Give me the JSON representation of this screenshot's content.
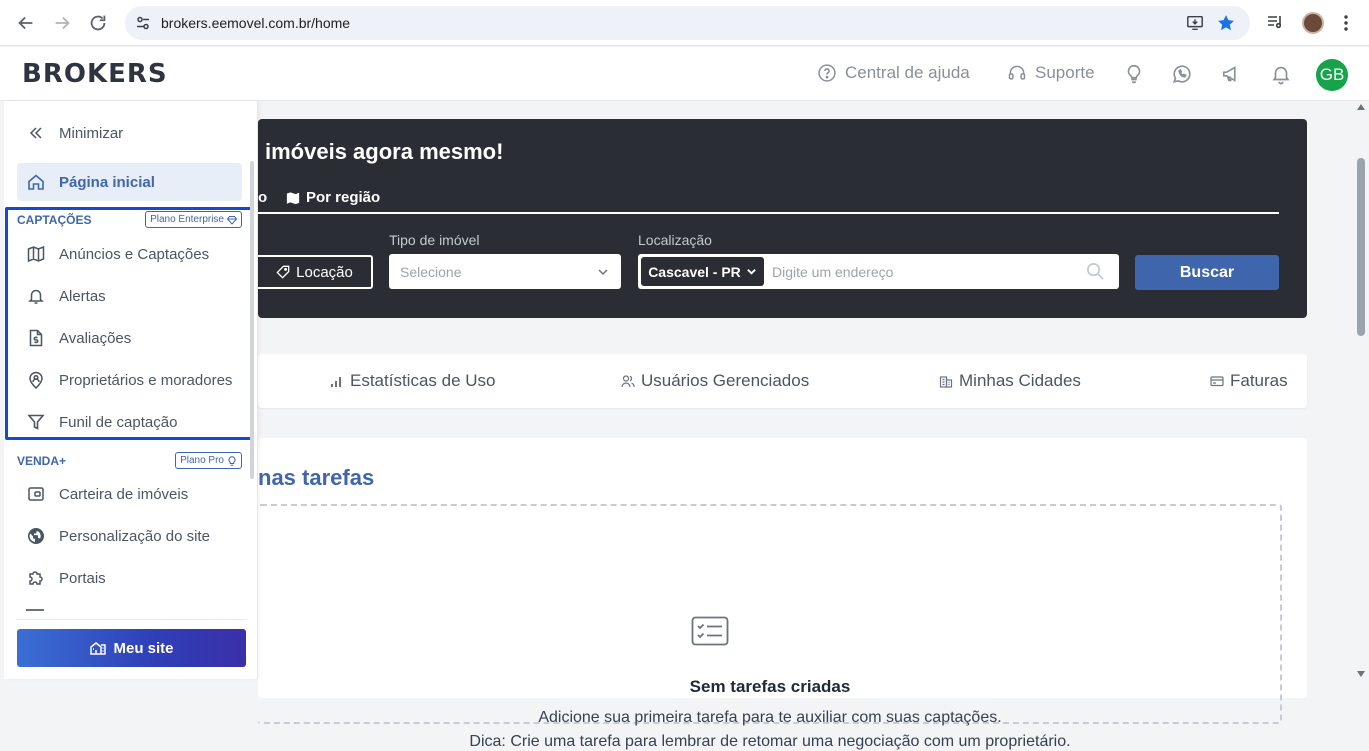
{
  "browser": {
    "url": "brokers.eemovel.com.br/home"
  },
  "header": {
    "logo": "BROKERS",
    "help_label": "Central de ajuda",
    "support_label": "Suporte",
    "avatar_initials": "GB",
    "avatar_color": "#16a34a"
  },
  "sidebar": {
    "minimize_label": "Minimizar",
    "home_label": "Página inicial",
    "captacoes": {
      "title": "CAPTAÇÕES",
      "plan": "Plano Enterprise",
      "items": [
        {
          "label": "Anúncios e Captações",
          "icon": "map-icon"
        },
        {
          "label": "Alertas",
          "icon": "bell-icon"
        },
        {
          "label": "Avaliações",
          "icon": "document-dollar-icon"
        },
        {
          "label": "Proprietários e moradores",
          "icon": "location-person-icon"
        },
        {
          "label": "Funil de captação",
          "icon": "filter-icon"
        }
      ]
    },
    "venda": {
      "title": "VENDA+",
      "plan": "Plano Pro",
      "items": [
        {
          "label": "Carteira de imóveis",
          "icon": "wallet-icon"
        },
        {
          "label": "Personalização do site",
          "icon": "globe-icon"
        },
        {
          "label": "Portais",
          "icon": "puzzle-icon"
        }
      ]
    },
    "my_site_label": "Meu site"
  },
  "hero": {
    "title": "imóveis agora mesmo!",
    "tab_partial": "o",
    "tab_region": "Por região",
    "rent_button": "Locação",
    "property_type_label": "Tipo de imóvel",
    "property_type_placeholder": "Selecione",
    "location_label": "Localização",
    "city": "Cascavel - PR",
    "address_placeholder": "Digite um endereço",
    "search_button": "Buscar"
  },
  "stats_bar": {
    "items": [
      {
        "label": "Estatísticas de Uso",
        "icon": "bar-chart-icon"
      },
      {
        "label": "Usuários Gerenciados",
        "icon": "users-icon"
      },
      {
        "label": "Minhas Cidades",
        "icon": "buildings-icon"
      },
      {
        "label": "Faturas",
        "icon": "card-icon"
      }
    ]
  },
  "tasks": {
    "heading": "nas tarefas",
    "empty_title": "Sem tarefas criadas",
    "empty_desc": "Adicione sua primeira tarefa para te auxiliar com suas captações.",
    "empty_tip": "Dica: Crie uma tarefa para lembrar de retomar uma negociação com um proprietário."
  },
  "colors": {
    "primary": "#3f66ad",
    "hero_bg": "#2a2d34",
    "highlight": "#1748d1"
  }
}
